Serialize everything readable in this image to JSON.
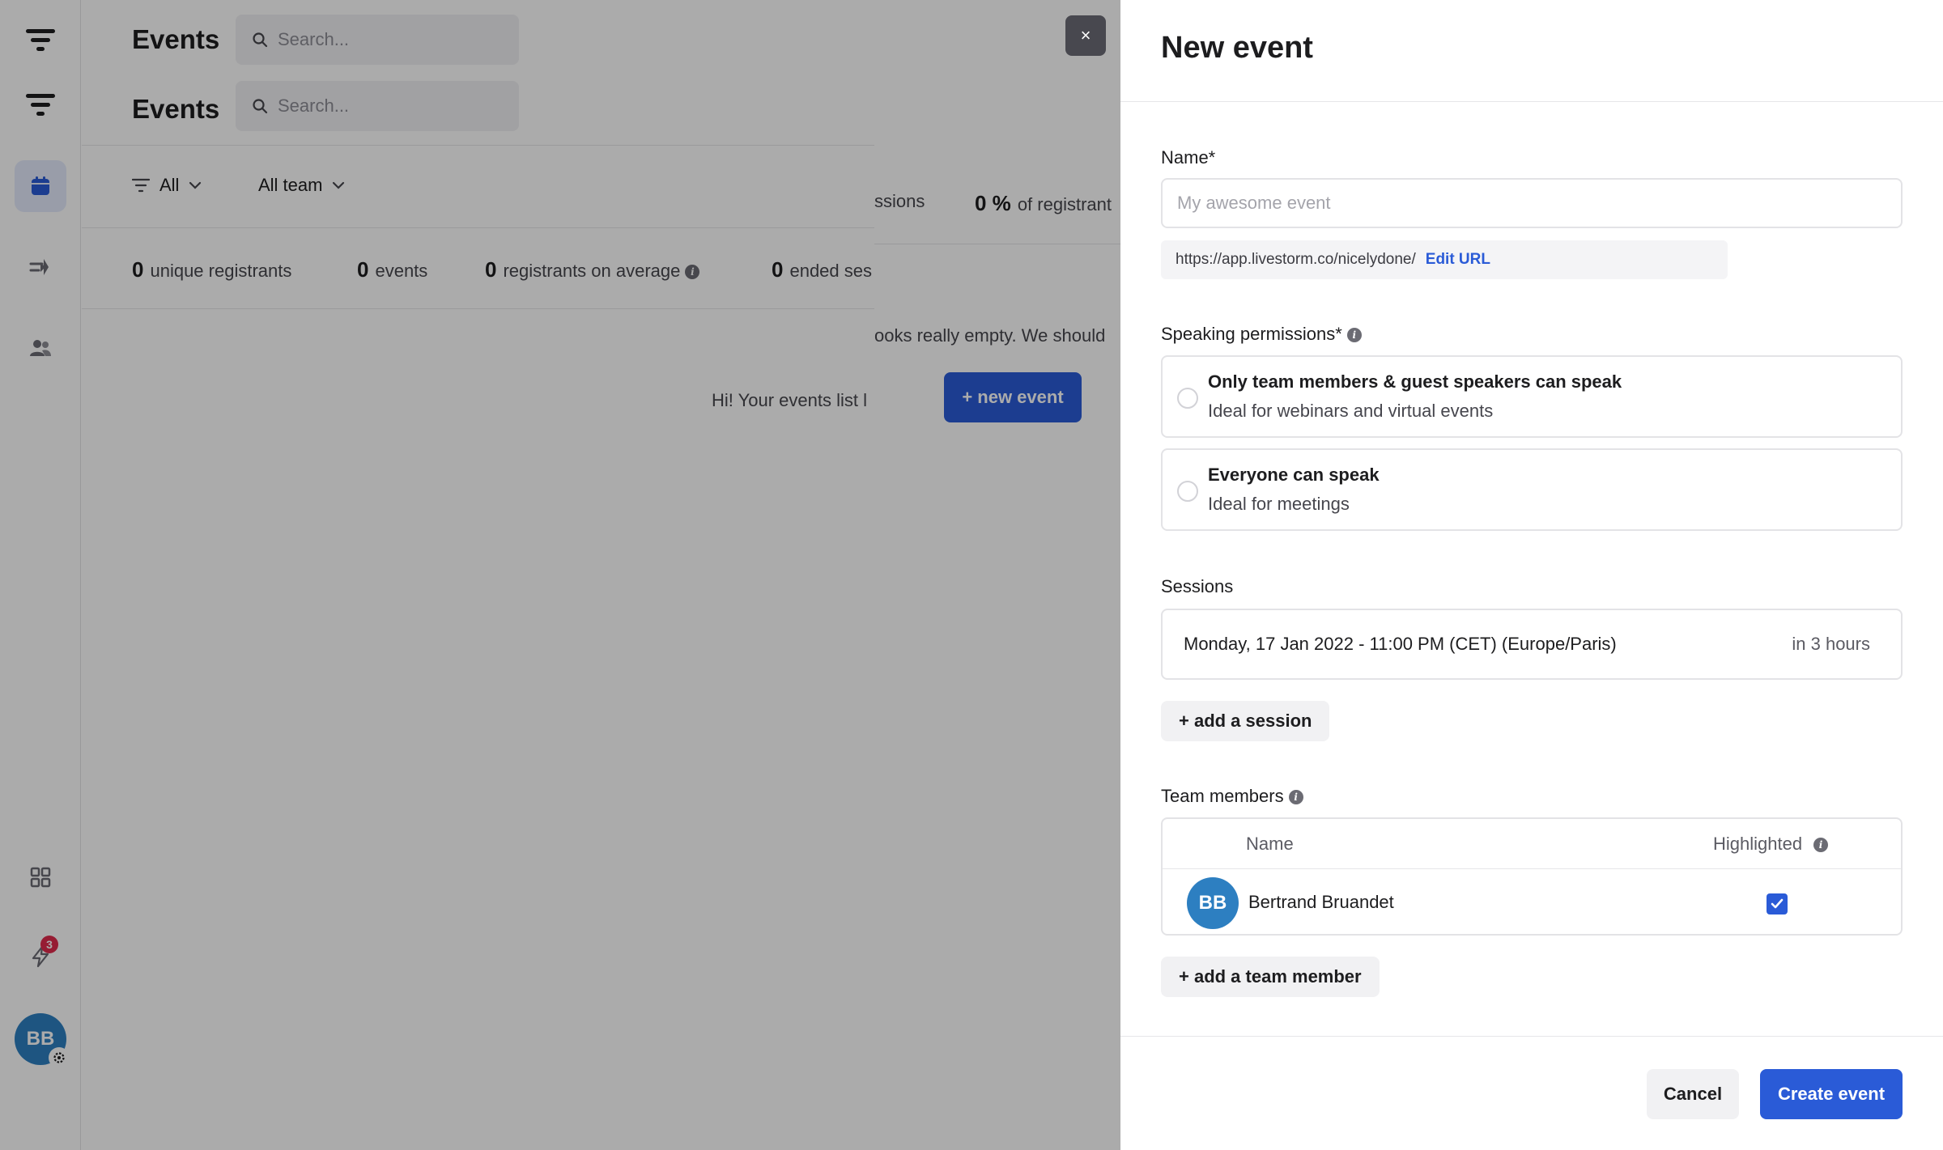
{
  "sidebar": {
    "items": [
      {
        "name": "logo-icon"
      },
      {
        "name": "logo-icon"
      },
      {
        "name": "calendar-icon",
        "active": true
      },
      {
        "name": "transitions-icon"
      },
      {
        "name": "people-icon"
      },
      {
        "name": "grid-icon"
      },
      {
        "name": "bolt-icon",
        "badge": "3"
      }
    ],
    "avatar_initials": "BB"
  },
  "main": {
    "title": "Events",
    "search_placeholder": "Search...",
    "filters": {
      "all_label": "All",
      "team_label": "All team"
    },
    "stats": [
      {
        "value": "0",
        "label": "unique registrants"
      },
      {
        "value": "0",
        "label": "events"
      },
      {
        "value": "0",
        "label": "registrants on average"
      },
      {
        "value": "0",
        "label": "ended ses"
      }
    ],
    "stats_right": [
      {
        "value": "",
        "label": "ssions"
      },
      {
        "value": "0 %",
        "label": "of registrant"
      }
    ],
    "empty_left": "Hi! Your events list l",
    "empty_right": "ooks really empty. We should",
    "new_event_button": "+ new event"
  },
  "overlay": {
    "close_symbol": "×"
  },
  "drawer": {
    "title": "New event",
    "name_label": "Name*",
    "name_placeholder": "My awesome event",
    "url": "https://app.livestorm.co/nicelydone/",
    "edit_url": "Edit URL",
    "speaking_label": "Speaking permissions*",
    "options": [
      {
        "title": "Only team members & guest speakers can speak",
        "desc": "Ideal for webinars and virtual events"
      },
      {
        "title": "Everyone can speak",
        "desc": "Ideal for meetings"
      }
    ],
    "sessions_label": "Sessions",
    "session": {
      "date": "Monday, 17 Jan 2022 - 11:00 PM (CET) (Europe/Paris)",
      "relative": "in 3 hours"
    },
    "add_session": "+ add a session",
    "team_label": "Team members",
    "team_table": {
      "col_name": "Name",
      "col_highlighted": "Highlighted",
      "rows": [
        {
          "initials": "BB",
          "name": "Bertrand Bruandet",
          "highlighted": true
        }
      ]
    },
    "add_member": "+ add a team member",
    "cancel": "Cancel",
    "create": "Create event"
  },
  "colors": {
    "accent": "#2a5bd7",
    "avatar": "#2d7fc1",
    "badge": "#e02b4c"
  }
}
